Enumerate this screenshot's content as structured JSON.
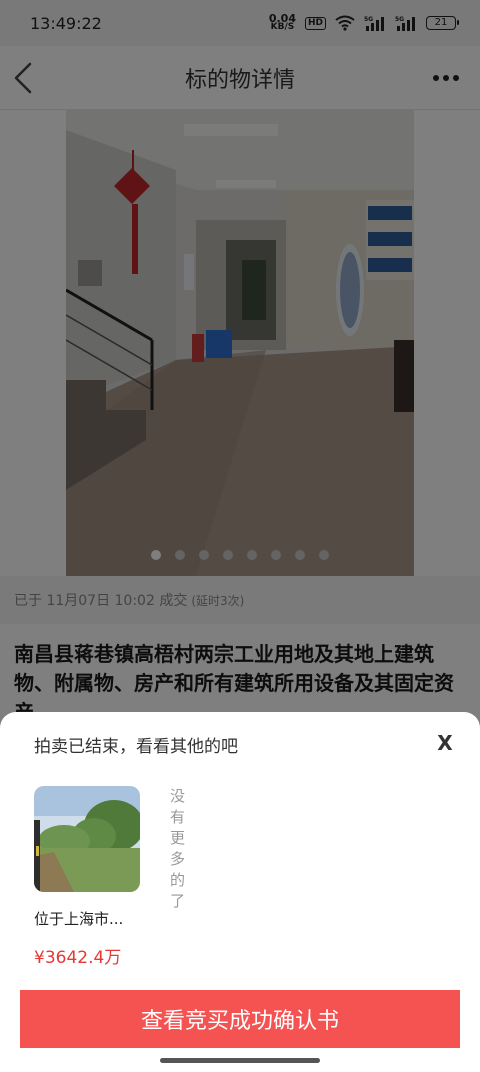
{
  "status_bar": {
    "time": "13:49:22",
    "net_speed_value": "0.04",
    "net_speed_unit": "KB/S",
    "hd_label": "HD",
    "signal_1_label": "5G",
    "signal_2_label": "5G",
    "battery": "21"
  },
  "header": {
    "title": "标的物详情",
    "back_icon": "chevron-left-icon",
    "more_icon": "more-dots-icon"
  },
  "carousel": {
    "total_slides": 8,
    "active_index": 0
  },
  "deal": {
    "text": "已于 11月07日 10:02 成交",
    "extra": "(延时3次)"
  },
  "lot": {
    "title": "南昌县蒋巷镇高梧村两宗工业用地及其地上建筑物、附属物、房产和所有建筑所用设备及其固定资产"
  },
  "sheet": {
    "title": "拍卖已结束，看看其他的吧",
    "close_label": "X",
    "recommendations": [
      {
        "location": "位于上海市...",
        "price": "¥3642.4万"
      }
    ],
    "no_more": "没有更多的了",
    "cta_label": "查看竞买成功确认书"
  },
  "colors": {
    "accent": "#f55252",
    "price": "#e53935",
    "overlay": "rgba(0,0,0,0.5)"
  }
}
